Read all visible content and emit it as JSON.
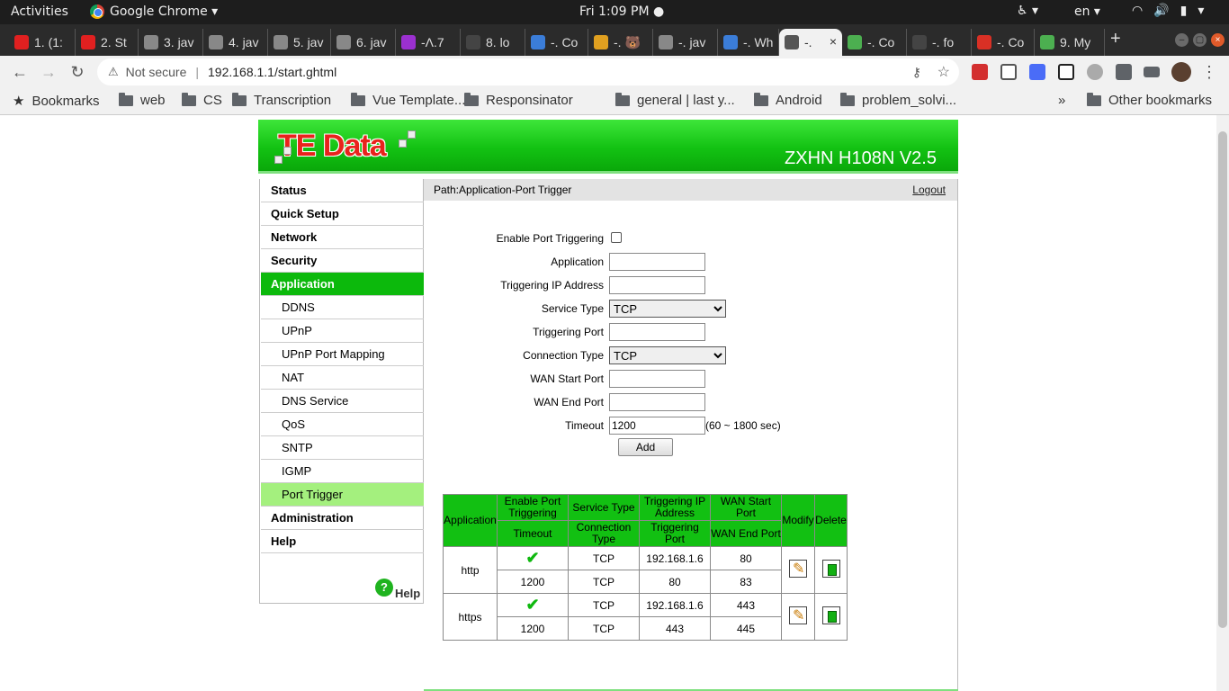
{
  "topbar": {
    "activities": "Activities",
    "app": "Google Chrome ▾",
    "clock": "Fri  1:09 PM ●",
    "lang": "en ▾"
  },
  "tabs": [
    {
      "label": "1. (1:",
      "color": "#e02020"
    },
    {
      "label": "2. St",
      "color": "#e02020"
    },
    {
      "label": "3. jav",
      "color": "#888888"
    },
    {
      "label": "4. jav",
      "color": "#888888"
    },
    {
      "label": "5. jav",
      "color": "#888888"
    },
    {
      "label": "6. jav",
      "color": "#888888"
    },
    {
      "label": "-Λ.7",
      "color": "#9b30d0"
    },
    {
      "label": "8. lo",
      "color": "#444444"
    },
    {
      "label": "-. Co",
      "color": "#3b7dd8"
    },
    {
      "label": "-. 🐻",
      "color": "#e0a020"
    },
    {
      "label": "-. jav",
      "color": "#888888"
    },
    {
      "label": "-. Wh",
      "color": "#3b7dd8"
    },
    {
      "label": "-.",
      "color": "#555555",
      "active": true
    },
    {
      "label": "-. Co",
      "color": "#4caf50"
    },
    {
      "label": "-. fo",
      "color": "#444444"
    },
    {
      "label": "-. Co",
      "color": "#d93025"
    },
    {
      "label": "9. My",
      "color": "#4caf50"
    }
  ],
  "toolbar": {
    "not_secure": "Not secure",
    "url": "192.168.1.1/start.ghtml"
  },
  "bookmarks": {
    "items": [
      "Bookmarks",
      "web",
      "CS",
      "Transcription",
      "Vue Template...",
      "Responsinator",
      "general | last y...",
      "Android",
      "problem_solvi..."
    ],
    "more": "»",
    "other": "Other bookmarks"
  },
  "router": {
    "logo_te": "TE",
    "logo_data": "Data",
    "model": "ZXHN H108N V2.5",
    "path": "Path:Application-Port Trigger",
    "logout": "Logout"
  },
  "sidebar": {
    "items": [
      {
        "label": "Status",
        "level": "top"
      },
      {
        "label": "Quick Setup",
        "level": "top"
      },
      {
        "label": "Network",
        "level": "top"
      },
      {
        "label": "Security",
        "level": "top"
      },
      {
        "label": "Application",
        "level": "top",
        "selected": true
      },
      {
        "label": "DDNS",
        "level": "sub"
      },
      {
        "label": "UPnP",
        "level": "sub"
      },
      {
        "label": "UPnP Port Mapping",
        "level": "sub"
      },
      {
        "label": "NAT",
        "level": "sub"
      },
      {
        "label": "DNS Service",
        "level": "sub"
      },
      {
        "label": "QoS",
        "level": "sub"
      },
      {
        "label": "SNTP",
        "level": "sub"
      },
      {
        "label": "IGMP",
        "level": "sub"
      },
      {
        "label": "Port Trigger",
        "level": "sub",
        "selected": true
      },
      {
        "label": "Administration",
        "level": "top"
      },
      {
        "label": "Help",
        "level": "top"
      }
    ],
    "help_label": "Help"
  },
  "form": {
    "enable_label": "Enable Port Triggering",
    "enable_checked": false,
    "application_label": "Application",
    "application_value": "",
    "trigger_ip_label": "Triggering IP Address",
    "trigger_ip_value": "",
    "service_type_label": "Service Type",
    "service_type_value": "TCP",
    "trigger_port_label": "Triggering Port",
    "trigger_port_value": "",
    "connection_type_label": "Connection Type",
    "connection_type_value": "TCP",
    "wan_start_label": "WAN Start Port",
    "wan_start_value": "",
    "wan_end_label": "WAN End Port",
    "wan_end_value": "",
    "timeout_label": "Timeout",
    "timeout_value": "1200",
    "timeout_hint": "(60 ~ 1800 sec)",
    "add_label": "Add"
  },
  "table": {
    "headers": {
      "application": "Application",
      "enable": "Enable Port Triggering",
      "service": "Service Type",
      "trig_ip": "Triggering IP Address",
      "wan_start": "WAN Start Port",
      "modify": "Modify",
      "delete": "Delete",
      "timeout": "Timeout",
      "conn_type": "Connection Type",
      "trig_port": "Triggering Port",
      "wan_end": "WAN End Port"
    },
    "rows": [
      {
        "application": "http",
        "enabled": "✔",
        "service": "TCP",
        "trig_ip": "192.168.1.6",
        "wan_start": "80",
        "timeout": "1200",
        "conn_type": "TCP",
        "trig_port": "80",
        "wan_end": "83"
      },
      {
        "application": "https",
        "enabled": "✔",
        "service": "TCP",
        "trig_ip": "192.168.1.6",
        "wan_start": "443",
        "timeout": "1200",
        "conn_type": "TCP",
        "trig_port": "443",
        "wan_end": "445"
      }
    ]
  }
}
